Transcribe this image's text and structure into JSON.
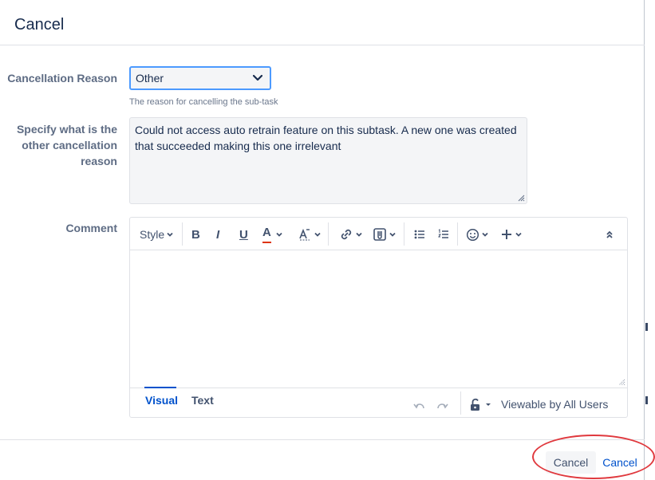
{
  "dialog": {
    "title": "Cancel"
  },
  "form": {
    "reason_label": "Cancellation Reason",
    "reason_value": "Other",
    "reason_help": "The reason for cancelling the sub-task",
    "other_label_lines": [
      "Specify what is the",
      "other cancellation",
      "reason"
    ],
    "other_lines": [
      "Could not access auto retrain feature on this subtask. A new one was created",
      "that succeeded making this one irrelevant"
    ],
    "comment_label": "Comment"
  },
  "editor": {
    "toolbar": {
      "style_label": "Style",
      "bold_label": "B",
      "italic_label": "I",
      "underline_label": "U",
      "text_color_label": "A",
      "text_color_value": "#de350b"
    },
    "tabs": {
      "visual": "Visual",
      "text": "Text"
    },
    "visibility": "Viewable by All Users"
  },
  "footer": {
    "cancel_button": "Cancel",
    "cancel_link": "Cancel"
  },
  "colors": {
    "accent": "#0052cc",
    "highlight": "#e0393e"
  }
}
